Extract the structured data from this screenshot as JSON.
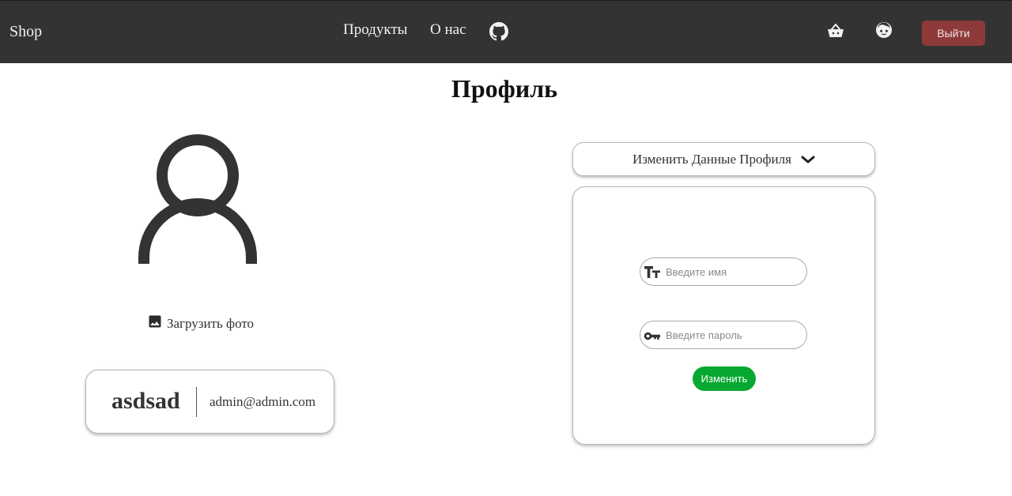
{
  "navbar": {
    "brand": "Shop",
    "links": [
      {
        "label": "Продукты"
      },
      {
        "label": "О нас"
      }
    ],
    "icons": [
      "github-icon",
      "basket-icon",
      "user-face-icon"
    ],
    "logout_label": "Выйти",
    "background_color": "#333333",
    "logout_color": "#8e3a3a"
  },
  "page": {
    "title": "Профиль"
  },
  "profile": {
    "avatar_icon": "user-avatar-icon",
    "upload_icon": "image-icon",
    "upload_label": "Загрузить фото",
    "username": "asdsad",
    "email": "admin@admin.com"
  },
  "edit_form": {
    "toggle_label": "Изменить Данные Профиля",
    "toggle_icon": "chevron-down-icon",
    "name_icon": "text-size-icon",
    "name_placeholder": "Введите имя",
    "name_value": "",
    "password_icon": "key-icon",
    "password_placeholder": "Введите пароль",
    "password_value": "",
    "submit_label": "Изменить",
    "submit_color": "#07a832"
  }
}
